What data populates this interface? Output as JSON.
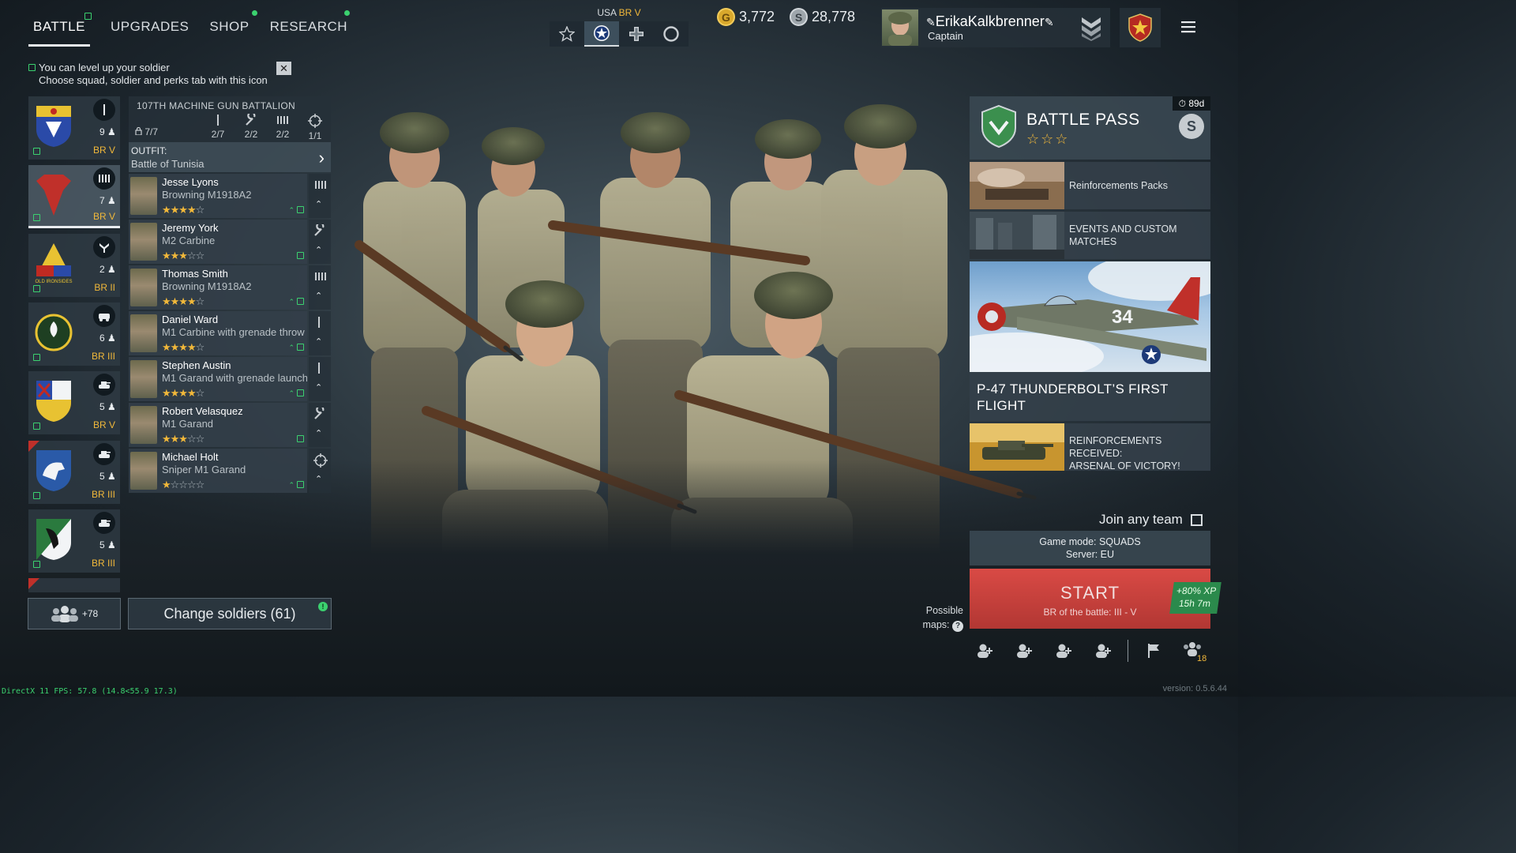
{
  "nav": {
    "tabs": [
      {
        "label": "BATTLE",
        "active": true
      },
      {
        "label": "UPGRADES"
      },
      {
        "label": "SHOP"
      },
      {
        "label": "RESEARCH"
      }
    ]
  },
  "hint": {
    "line1": "You can level up your soldier",
    "line2": "Choose squad, soldier and perks tab with this icon",
    "close_label": "✕"
  },
  "nation": {
    "country": "USA",
    "br": "BR V",
    "buttons": [
      "star-outline-icon",
      "us-roundel-icon",
      "cross-icon",
      "circle-icon"
    ]
  },
  "currency": {
    "gold": "3,772",
    "silver": "28,778",
    "gold_symbol": "G",
    "silver_symbol": "S"
  },
  "profile": {
    "name": "ErikaKalkbrenner",
    "rank": "Captain"
  },
  "squads": [
    {
      "count": "9",
      "br": "BR V",
      "type": "rifle-icon"
    },
    {
      "count": "7",
      "br": "BR V",
      "type": "machine-gun-icon",
      "active": true
    },
    {
      "count": "2",
      "br": "BR II",
      "type": "engineer-icon"
    },
    {
      "count": "6",
      "br": "BR III",
      "type": "vehicle-icon"
    },
    {
      "count": "5",
      "br": "BR V",
      "type": "tank-icon"
    },
    {
      "count": "5",
      "br": "BR III",
      "type": "tank-icon"
    },
    {
      "count": "5",
      "br": "BR III",
      "type": "tank-icon"
    }
  ],
  "bottom": {
    "reserve_count": "+78",
    "change_soldiers": "Change soldiers (61)",
    "change_badge": "!"
  },
  "squad_panel": {
    "title": "107TH MACHINE GUN BATTALION",
    "slots": "7/7",
    "stats": [
      "2/7",
      "2/2",
      "2/2",
      "1/1"
    ],
    "outfit_label": "OUTFIT:",
    "outfit_value": "Battle of Tunisia",
    "soldiers": [
      {
        "name": "Jesse Lyons",
        "weapon": "Browning M1918A2",
        "stars_full": "★★★★",
        "stars_empty": "☆",
        "rank_marks": "⌃",
        "icon": "machine-gun-icon"
      },
      {
        "name": "Jeremy York",
        "weapon": "M2 Carbine",
        "stars_full": "★★★",
        "stars_empty": "☆☆",
        "rank_marks": "⌃",
        "icon": "wrench-icon"
      },
      {
        "name": "Thomas Smith",
        "weapon": "Browning M1918A2",
        "stars_full": "★★★★",
        "stars_empty": "☆",
        "rank_marks": "⌃",
        "icon": "machine-gun-icon"
      },
      {
        "name": "Daniel Ward",
        "weapon": "M1 Carbine with grenade throw",
        "stars_full": "★★★★",
        "stars_empty": "☆",
        "rank_marks": "⌃",
        "icon": "rifle-icon"
      },
      {
        "name": "Stephen Austin",
        "weapon": "M1 Garand with grenade launch",
        "stars_full": "★★★★",
        "stars_empty": "☆",
        "rank_marks": "⌃",
        "icon": "rifle-icon"
      },
      {
        "name": "Robert Velasquez",
        "weapon": "M1 Garand",
        "stars_full": "★★★",
        "stars_empty": "☆☆",
        "rank_marks": "⌃",
        "icon": "wrench-icon"
      },
      {
        "name": "Michael Holt",
        "weapon": "Sniper M1 Garand",
        "stars_full": "★",
        "stars_empty": "☆☆☆☆",
        "rank_marks": "⌃",
        "icon": "crosshair-icon"
      }
    ]
  },
  "battle_pass": {
    "title": "BATTLE PASS",
    "timer": "89d",
    "stars": "☆☆☆",
    "badge": "S"
  },
  "promos": {
    "reinforcements": "Reinforcements Packs",
    "events_line1": "EVENTS AND CUSTOM",
    "events_line2": "MATCHES",
    "feature_line1": "P-47 THUNDERBOLT’S FIRST",
    "feature_line2": "FLIGHT",
    "feature_plane_number": "34",
    "arsenal_line1": "REINFORCEMENTS RECEIVED:",
    "arsenal_line2": "ARSENAL OF VICTORY!"
  },
  "matchmaking": {
    "join_any_team": "Join any team",
    "game_mode": "Game mode: SQUADS",
    "server": "Server: EU",
    "start": "START",
    "battle_br": "BR of the battle: III - V",
    "xp_bonus": "+80% XP",
    "xp_time": "15h 7m",
    "possible": "Possible",
    "maps": "maps:",
    "party_count": "18"
  },
  "footer": {
    "fps": "DirectX 11 FPS: 57.8 (14.8<55.9 17.3)",
    "version": "version: 0.5.6.44"
  }
}
